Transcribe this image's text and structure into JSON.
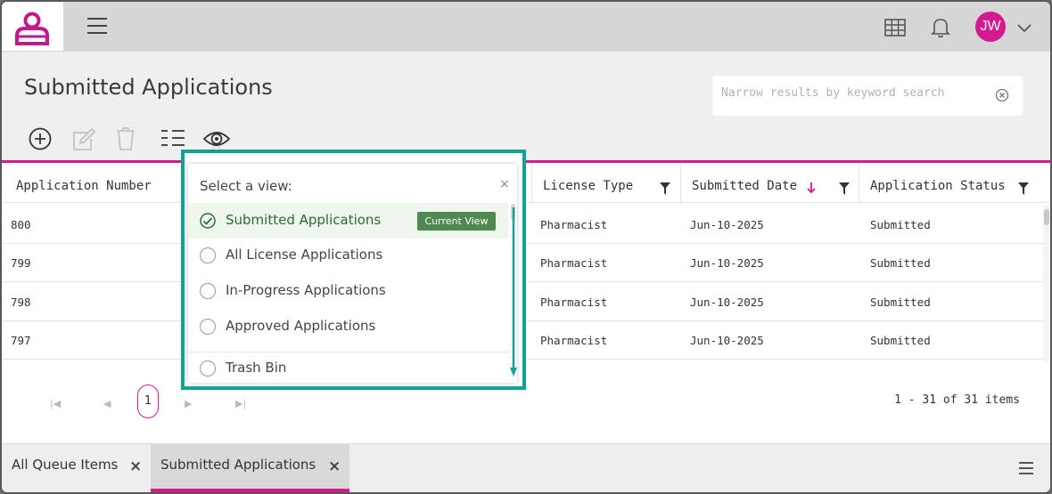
{
  "header": {
    "logo_icon": "user-lock-icon",
    "menu_icon": "hamburger-icon",
    "apps_icon": "grid-icon",
    "notifications_icon": "bell-icon",
    "avatar_initials": "JW",
    "avatar_color": "#d41a8f",
    "accent_color": "#d41a8f"
  },
  "page": {
    "title": "Submitted Applications",
    "search_placeholder": "Narrow results by keyword search"
  },
  "toolbar": {
    "icons": [
      "add-circle-icon",
      "edit-icon",
      "trash-icon",
      "columns-list-icon",
      "eye-icon"
    ]
  },
  "table": {
    "columns": [
      {
        "label": "Application Number"
      },
      {
        "label": "License Type"
      },
      {
        "label": "Submitted Date"
      },
      {
        "label": "Application Status"
      }
    ],
    "sort": {
      "column": "Submitted Date",
      "direction": "desc"
    },
    "rows": [
      {
        "number": "800",
        "license": "Pharmacist",
        "date": "Jun-10-2025",
        "status": "Submitted"
      },
      {
        "number": "799",
        "license": "Pharmacist",
        "date": "Jun-10-2025",
        "status": "Submitted"
      },
      {
        "number": "798",
        "license": "Pharmacist",
        "date": "Jun-10-2025",
        "status": "Submitted"
      },
      {
        "number": "797",
        "license": "Pharmacist",
        "date": "Jun-10-2025",
        "status": "Submitted"
      }
    ]
  },
  "pager": {
    "current_page": "1",
    "info": "1 - 31 of 31 items"
  },
  "view_dropdown": {
    "heading": "Select a view:",
    "close": "×",
    "current_badge": "Current View",
    "highlight_color": "#11a392",
    "items": [
      {
        "label": "Submitted Applications",
        "current": true
      },
      {
        "label": "All License Applications",
        "current": false
      },
      {
        "label": "In-Progress Applications",
        "current": false
      },
      {
        "label": "Approved Applications",
        "current": false
      },
      {
        "label": "Trash Bin",
        "current": false
      }
    ]
  },
  "bottom_tabs": [
    {
      "label": "All Queue Items",
      "close": "×",
      "active": false
    },
    {
      "label": "Submitted Applications",
      "close": "×",
      "active": true
    }
  ]
}
